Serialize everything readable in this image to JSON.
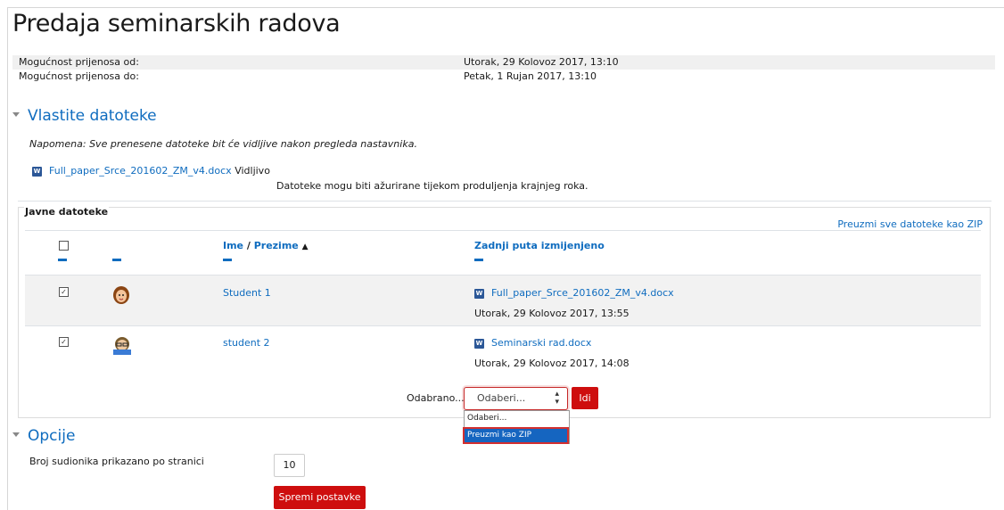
{
  "page_title": "Predaja seminarskih radova",
  "info": [
    {
      "label": "Mogućnost prijenosa od:",
      "value": "Utorak, 29 Kolovoz 2017, 13:10"
    },
    {
      "label": "Mogućnost prijenosa do:",
      "value": "Petak, 1 Rujan 2017, 13:10"
    }
  ],
  "own_files": {
    "heading": "Vlastite datoteke",
    "note": "Napomena: Sve prenesene datoteke bit će vidljive nakon pregleda nastavnika.",
    "file_name": "Full_paper_Srce_201602_ZM_v4.docx",
    "file_status": "Vidljivo",
    "update_note": "Datoteke mogu biti ažurirane tijekom produljenja krajnjeg roka."
  },
  "public_files": {
    "legend": "Javne datoteke",
    "download_all": "Preuzmi sve datoteke kao ZIP",
    "columns": {
      "first_name": "Ime",
      "separator": " / ",
      "last_name": "Prezime",
      "modified": "Zadnji puta izmijenjeno"
    },
    "sort_icon": "triangle-up-icon",
    "rows": [
      {
        "name": "Student 1",
        "file": "Full_paper_Srce_201602_ZM_v4.docx",
        "date": "Utorak, 29 Kolovoz 2017, 13:55",
        "checked": true
      },
      {
        "name": "student 2",
        "file": "Seminarski rad.docx",
        "date": "Utorak, 29 Kolovoz 2017, 14:08",
        "checked": true
      }
    ],
    "bulk_label": "Odabrano...",
    "select_value": "Odaberi...",
    "go_button": "Idi",
    "dropdown_options": [
      "Odaberi...",
      "Preuzmi kao ZIP"
    ]
  },
  "options": {
    "heading": "Opcije",
    "per_page_label": "Broj sudionika prikazano po stranici",
    "per_page_value": "10",
    "save_button": "Spremi postavke"
  },
  "colors": {
    "link": "#0f6cbf",
    "accent_red": "#ce0e0e",
    "highlight_blue": "#1565c0"
  }
}
